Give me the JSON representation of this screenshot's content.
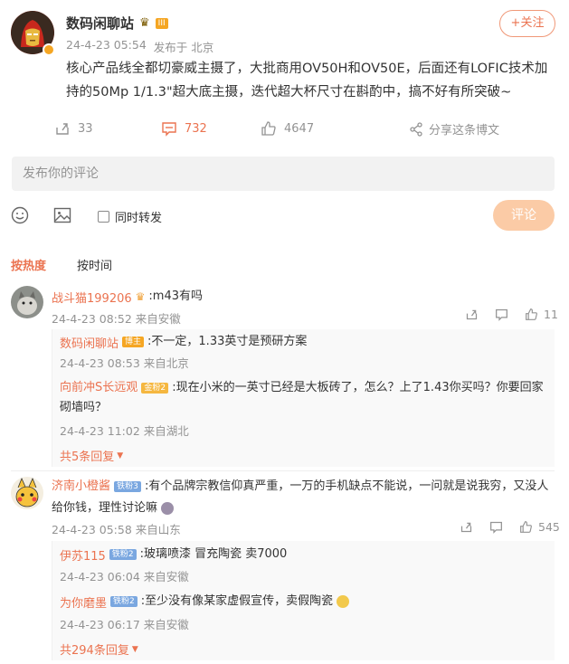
{
  "post": {
    "author": "数码闲聊站",
    "level_badge": "III",
    "time": "24-4-23 05:54",
    "location": "发布于 北京",
    "follow": "+关注",
    "text": "核心产品线全都切豪威主摄了，大批商用OV50H和OV50E，后面还有LOFIC技术加持的50Mp 1/1.3\"超大底主摄，迭代超大杯尺寸在斟酌中，搞不好有所突破~",
    "reposts": "33",
    "comments": "732",
    "likes": "4647",
    "share": "分享这条博文"
  },
  "composer": {
    "placeholder": "发布你的评论",
    "repost_label": "同时转发",
    "submit": "评论"
  },
  "tabs": {
    "hot": "按热度",
    "time": "按时间"
  },
  "comments": [
    {
      "user": "战斗猫199206",
      "text": ":m43有吗",
      "meta": "24-4-23 08:52 来自安徽",
      "likes": "11",
      "replies": [
        {
          "user": "数码闲聊站",
          "badge": "博主",
          "text": ":不一定，1.33英寸是预研方案",
          "meta": "24-4-23 08:53 来自北京"
        },
        {
          "user": "向前冲S长远观",
          "badge": "金粉2",
          "text": ":现在小米的一英寸已经是大板砖了，怎么？上了1.43你买吗？你要回家砌墙吗？",
          "meta": "24-4-23 11:02 来自湖北"
        }
      ],
      "more": "共5条回复"
    },
    {
      "user": "济南小橙酱",
      "badge": "铁粉3",
      "text": ":有个品牌宗教信仰真严重，一万的手机缺点不能说，一问就是说我穷，又没人给你钱，理性讨论嘛",
      "meta": "24-4-23 05:58 来自山东",
      "likes": "545",
      "replies": [
        {
          "user": "伊苏115",
          "badge": "铁粉2",
          "text": ":玻璃喷漆 冒充陶瓷 卖7000",
          "meta": "24-4-23 06:04 来自安徽"
        },
        {
          "user": "为你磨墨",
          "badge": "铁粉2",
          "text": ":至少没有像某家虚假宣传，卖假陶瓷",
          "meta": "24-4-23 06:17 来自安徽"
        }
      ],
      "more": "共294条回复"
    }
  ],
  "colors": {
    "accent": "#eb7350",
    "meta": "#939393",
    "submit_bg": "#fbcba6",
    "input_bg": "#f2f2f2"
  }
}
